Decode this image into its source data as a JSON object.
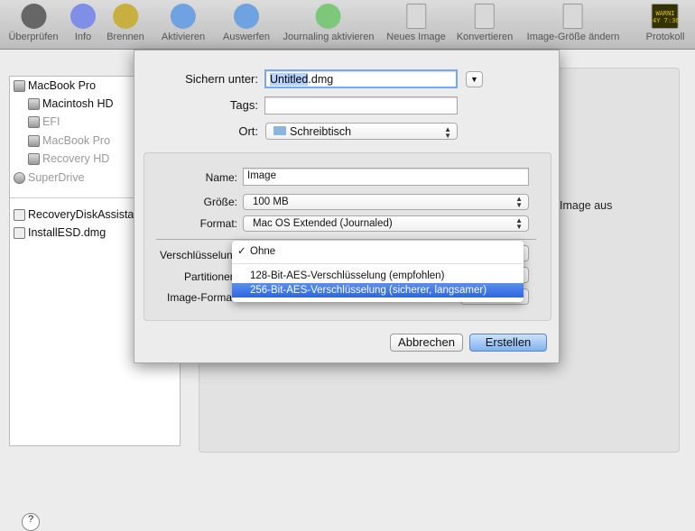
{
  "toolbar": [
    {
      "label": "Überprüfen",
      "icon": "microscope-icon",
      "color": "#666666"
    },
    {
      "label": "Info",
      "icon": "info-icon",
      "color": "#7f8fe8"
    },
    {
      "label": "Brennen",
      "icon": "burn-icon",
      "color": "#c8b040"
    },
    {
      "label": "Aktivieren",
      "icon": "mount-icon",
      "color": "#6fa2e0"
    },
    {
      "label": "Auswerfen",
      "icon": "eject-icon",
      "color": "#6fa2e0"
    },
    {
      "label": "Journaling aktivieren",
      "icon": "journaling-icon",
      "color": "#7cc77a"
    },
    {
      "label": "Neues Image",
      "icon": "new-image-icon",
      "color": "#d8d8d8"
    },
    {
      "label": "Konvertieren",
      "icon": "convert-icon",
      "color": "#d8d8d8"
    },
    {
      "label": "Image-Größe ändern",
      "icon": "resize-image-icon",
      "color": "#d8d8d8"
    },
    {
      "label": "Protokoll",
      "icon": "log-icon",
      "color": "#333300"
    }
  ],
  "protocol_icon_text": [
    "WARNI",
    "4Y 7:36"
  ],
  "sidebar": {
    "disks": [
      {
        "label": "MacBook Pro",
        "dim": false
      },
      {
        "label": "Macintosh HD",
        "dim": false
      },
      {
        "label": "EFI",
        "dim": true
      },
      {
        "label": "MacBook Pro",
        "dim": true
      },
      {
        "label": "Recovery HD",
        "dim": true
      },
      {
        "label": "SuperDrive",
        "dim": true
      }
    ],
    "images": [
      "RecoveryDiskAssistant.dmg",
      "InstallESD.dmg"
    ]
  },
  "background_text": "Image aus",
  "help": "?",
  "dialog": {
    "save_as_label": "Sichern unter:",
    "save_as_selected": "Untitled",
    "save_as_ext": ".dmg",
    "tags_label": "Tags:",
    "tags_value": "",
    "where_label": "Ort:",
    "where_value": "Schreibtisch",
    "name_label": "Name:",
    "name_value": "Image",
    "size_label": "Größe:",
    "size_value": "100 MB",
    "format_label": "Format:",
    "format_value": "Mac OS Extended (Journaled)",
    "encryption_label": "Verschlüsselung:",
    "partitions_label": "Partitionen:",
    "image_format_label": "Image-Format:",
    "encryption_menu": [
      {
        "label": "Ohne",
        "checked": true,
        "highlighted": false
      },
      {
        "label": "128-Bit-AES-Verschlüsselung (empfohlen)",
        "checked": false,
        "highlighted": false
      },
      {
        "label": "256-Bit-AES-Verschlüsselung (sicherer, langsamer)",
        "checked": false,
        "highlighted": true
      }
    ],
    "check": "✓",
    "cancel": "Abbrechen",
    "create": "Erstellen"
  }
}
